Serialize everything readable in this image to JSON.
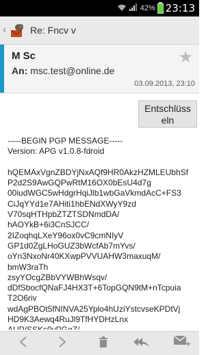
{
  "status": {
    "time": "23:13",
    "battery": "42%"
  },
  "actionbar": {
    "title": "Re: Fncv v"
  },
  "header": {
    "sender": "M Sc",
    "to_label": "An:",
    "to_address": "msc.test@online.de",
    "date": "03.09.2013, 23:10"
  },
  "decrypt_button": {
    "line1": "Entschlüss",
    "line2": "eln"
  },
  "message_lines": [
    "-----BEGIN PGP MESSAGE-----",
    "Version: APG v1.0.8-fdroid",
    "",
    "hQEMAxVgnZBDYjNxAQf9HR0AkzHZMLEUbhSf",
    "P2d2S9AwGQPwRtM16OX0bEsU4d7g",
    "00iudWGC5wHdgrHqiJlb1wbGaVkmdAcC+FS3",
    "CiJqYYd1e7AHiti1hbENdXWyY9zd",
    "V70sqHTHpbZTZTSDNmdDA/",
    "hAOYkB+6i3CnSJCC/",
    "2IZoqhqLXeY96ox0vC9cmNIyV",
    "GP1d0ZgLHoGUZ3bWcfAb7mYvs/",
    "oYn3NxoNr40KXwpPVVUAHW3maxuqM/",
    "bmW3raTh",
    "zsyYOcgZBbVYWBhWsqv/",
    "dDfSbocfQNaFJ4HX3T+6TopGQN9tM+nTcpuia",
    "T2O6riv",
    "wdAgPBOt5fNINVA25Yplo4hUziYstcvseKPDtVj",
    "HD9K3Aewq4RuJl9TfHYDHzLnx",
    "AUP/SSKs0vPGgZ/"
  ]
}
